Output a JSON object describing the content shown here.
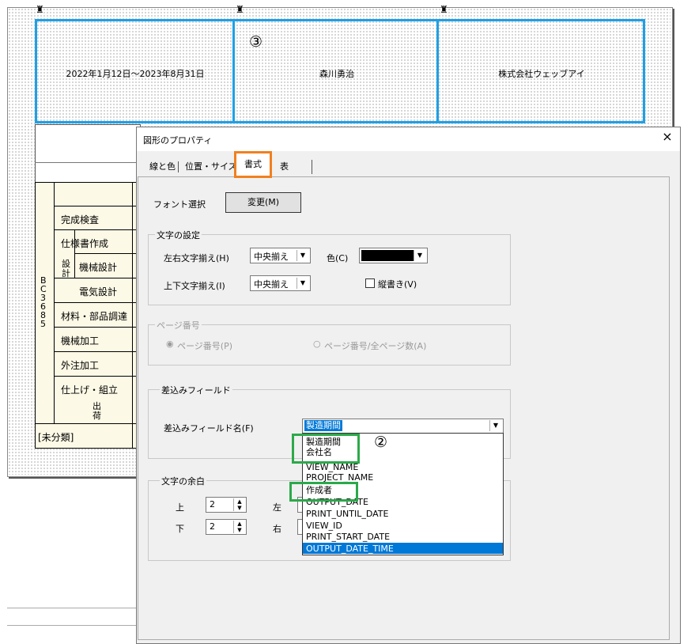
{
  "top_fields": {
    "period": "2022年1月12日～2023年8月31日",
    "author": "森川勇治",
    "company": "株式会社ウェッブアイ",
    "callout": "③"
  },
  "left_table": {
    "rows": [
      "完成検査",
      "仕様書作成",
      "機械設計",
      "電気設計",
      "材料・部品調達",
      "機械加工",
      "外注加工",
      "仕上げ・組立"
    ],
    "design_label": "設計",
    "shipping_label": "出荷",
    "code": "BC3685",
    "unclassified": "[未分類]"
  },
  "dialog": {
    "title": "図形のプロパティ",
    "close": "×",
    "tabs": [
      "線と色",
      "位置・サイズ",
      "書式",
      "表"
    ],
    "active_tab": "書式",
    "font_select_label": "フォント選択",
    "change_button": "変更(M)",
    "text_settings": {
      "group_title": "文字の設定",
      "h_align_label": "左右文字揃え(H)",
      "h_align_value": "中央揃え",
      "color_label": "色(C)",
      "color_value": "#000000",
      "v_align_label": "上下文字揃え(I)",
      "v_align_value": "中央揃え",
      "vertical_label": "縦書き(V)"
    },
    "page_number": {
      "group_title": "ページ番号",
      "option1": "ページ番号(P)",
      "option2": "ページ番号/全ページ数(A)"
    },
    "merge_field": {
      "group_title": "差込みフィールド",
      "label": "差込みフィールド名(F)",
      "value": "製造期間",
      "callout": "②",
      "options": [
        "製造期間",
        "会社名",
        "VIEW_NAME",
        "PROJECT_NAME",
        "作成者",
        "OUTPUT_DATE",
        "PRINT_UNTIL_DATE",
        "VIEW_ID",
        "PRINT_START_DATE",
        "OUTPUT_DATE_TIME"
      ],
      "selected_option": "OUTPUT_DATE_TIME"
    },
    "margins": {
      "group_title": "文字の余白",
      "top_label": "上",
      "top_value": "2",
      "bottom_label": "下",
      "bottom_value": "2",
      "left_label": "左",
      "right_label": "右"
    }
  },
  "colors": {
    "highlight_blue": "#1ea0e6",
    "highlight_orange": "#f08020",
    "highlight_green": "#2ca94a",
    "selection": "#0078d7"
  }
}
